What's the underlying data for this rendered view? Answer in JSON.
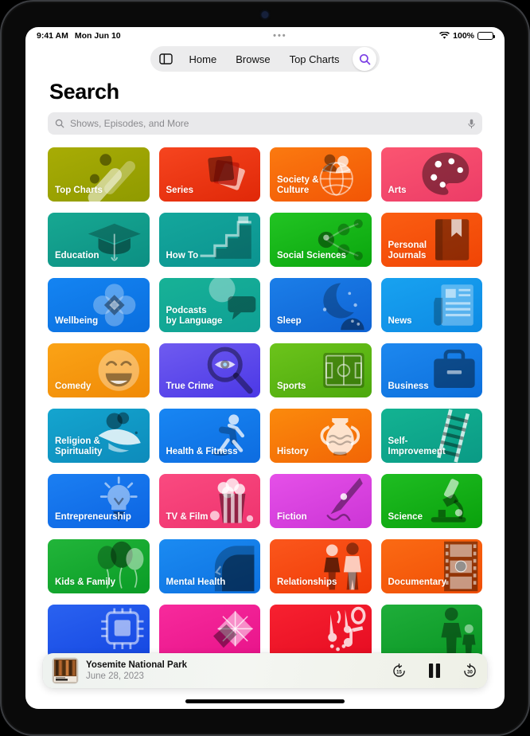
{
  "status_bar": {
    "time": "9:41 AM",
    "date": "Mon Jun 10",
    "center_dots": "•••",
    "wifi_icon": "wifi-icon",
    "battery_percent": "100%",
    "battery_icon": "battery-full-icon"
  },
  "nav": {
    "sidebar_icon": "sidebar-toggle-icon",
    "tabs": [
      {
        "label": "Home",
        "active": false
      },
      {
        "label": "Browse",
        "active": false
      },
      {
        "label": "Top Charts",
        "active": false
      }
    ],
    "search_icon": "search-icon",
    "search_active": true,
    "accent_color": "#7b3fe4"
  },
  "page": {
    "title": "Search"
  },
  "search": {
    "icon": "search-icon",
    "placeholder": "Shows, Episodes, and More",
    "value": "",
    "mic_icon": "microphone-icon"
  },
  "grid": {
    "tiles": [
      {
        "label": "Top Charts",
        "art": "chart",
        "c1": "#a8ac05",
        "c2": "#8f9a00"
      },
      {
        "label": "Series",
        "art": "cards",
        "c1": "#f6451f",
        "c2": "#e02808"
      },
      {
        "label": "Society & Culture",
        "art": "globe",
        "c1": "#fb7a10",
        "c2": "#f25505"
      },
      {
        "label": "Arts",
        "art": "palette",
        "c1": "#fb5571",
        "c2": "#ec3c67"
      },
      {
        "label": "Education",
        "art": "graduation",
        "c1": "#17a892",
        "c2": "#0c8f83"
      },
      {
        "label": "How To",
        "art": "stairs",
        "c1": "#14a79c",
        "c2": "#0b9390"
      },
      {
        "label": "Social Sciences",
        "art": "network",
        "c1": "#22c423",
        "c2": "#0aa60d"
      },
      {
        "label": "Personal Journals",
        "art": "book",
        "c1": "#fb5e12",
        "c2": "#f04405"
      },
      {
        "label": "Wellbeing",
        "art": "flower",
        "c1": "#1484f2",
        "c2": "#0a6ede"
      },
      {
        "label": "Podcasts\nby Language",
        "art": "bubbles",
        "c1": "#17b296",
        "c2": "#0f9f95"
      },
      {
        "label": "Sleep",
        "art": "moon",
        "c1": "#1b7ee8",
        "c2": "#0f63d4"
      },
      {
        "label": "News",
        "art": "newspaper",
        "c1": "#18a2f0",
        "c2": "#0d8ae4"
      },
      {
        "label": "Comedy",
        "art": "smiley",
        "c1": "#fba316",
        "c2": "#f08a06"
      },
      {
        "label": "True Crime",
        "art": "magnifier",
        "c1": "#6f5bf0",
        "c2": "#4b38e6"
      },
      {
        "label": "Sports",
        "art": "pitch",
        "c1": "#6cc41b",
        "c2": "#4ca80d"
      },
      {
        "label": "Business",
        "art": "briefcase",
        "c1": "#1d88ef",
        "c2": "#0c6fdc"
      },
      {
        "label": "Religion &\nSpirituality",
        "art": "dove",
        "c1": "#14a5cf",
        "c2": "#0d8bbb"
      },
      {
        "label": "Health & Fitness",
        "art": "runner",
        "c1": "#1886f3",
        "c2": "#0d6ce0"
      },
      {
        "label": "History",
        "art": "vase",
        "c1": "#fb8a0c",
        "c2": "#f26505"
      },
      {
        "label": "Self-Improvement",
        "art": "ladder",
        "c1": "#13b392",
        "c2": "#0a9a85"
      },
      {
        "label": "Entrepreneurship",
        "art": "bulb",
        "c1": "#1b7ff2",
        "c2": "#0c64e2"
      },
      {
        "label": "TV & Film",
        "art": "popcorn",
        "c1": "#fa4a80",
        "c2": "#ee336e"
      },
      {
        "label": "Fiction",
        "art": "pen",
        "c1": "#e550e8",
        "c2": "#cc35d6"
      },
      {
        "label": "Science",
        "art": "microscope",
        "c1": "#1fbd22",
        "c2": "#09a10c"
      },
      {
        "label": "Kids & Family",
        "art": "balloons",
        "c1": "#22b53a",
        "c2": "#0a9c26"
      },
      {
        "label": "Mental Health",
        "art": "head",
        "c1": "#1b8bf2",
        "c2": "#0d71e0"
      },
      {
        "label": "Relationships",
        "art": "couple",
        "c1": "#fb571c",
        "c2": "#f03a07"
      },
      {
        "label": "Documentary",
        "art": "filmstrip",
        "c1": "#fb6a14",
        "c2": "#f04e05"
      },
      {
        "label": "",
        "art": "chip",
        "c1": "#2a62f0",
        "c2": "#1547e2"
      },
      {
        "label": "",
        "art": "fashion",
        "c1": "#f72a9c",
        "c2": "#e8138a"
      },
      {
        "label": "",
        "art": "music",
        "c1": "#f72130",
        "c2": "#e60c22"
      },
      {
        "label": "",
        "art": "parenting",
        "c1": "#1fae3a",
        "c2": "#0a9624"
      }
    ]
  },
  "player": {
    "artwork_alt": "Field Trip",
    "title": "Yosemite National Park",
    "subtitle": "June 28, 2023",
    "skip_back_label": "15",
    "skip_back_icon": "skip-back-15-icon",
    "play_state": "playing",
    "pause_icon": "pause-icon",
    "skip_forward_label": "30",
    "skip_forward_icon": "skip-forward-30-icon"
  },
  "home_indicator": "home-indicator"
}
